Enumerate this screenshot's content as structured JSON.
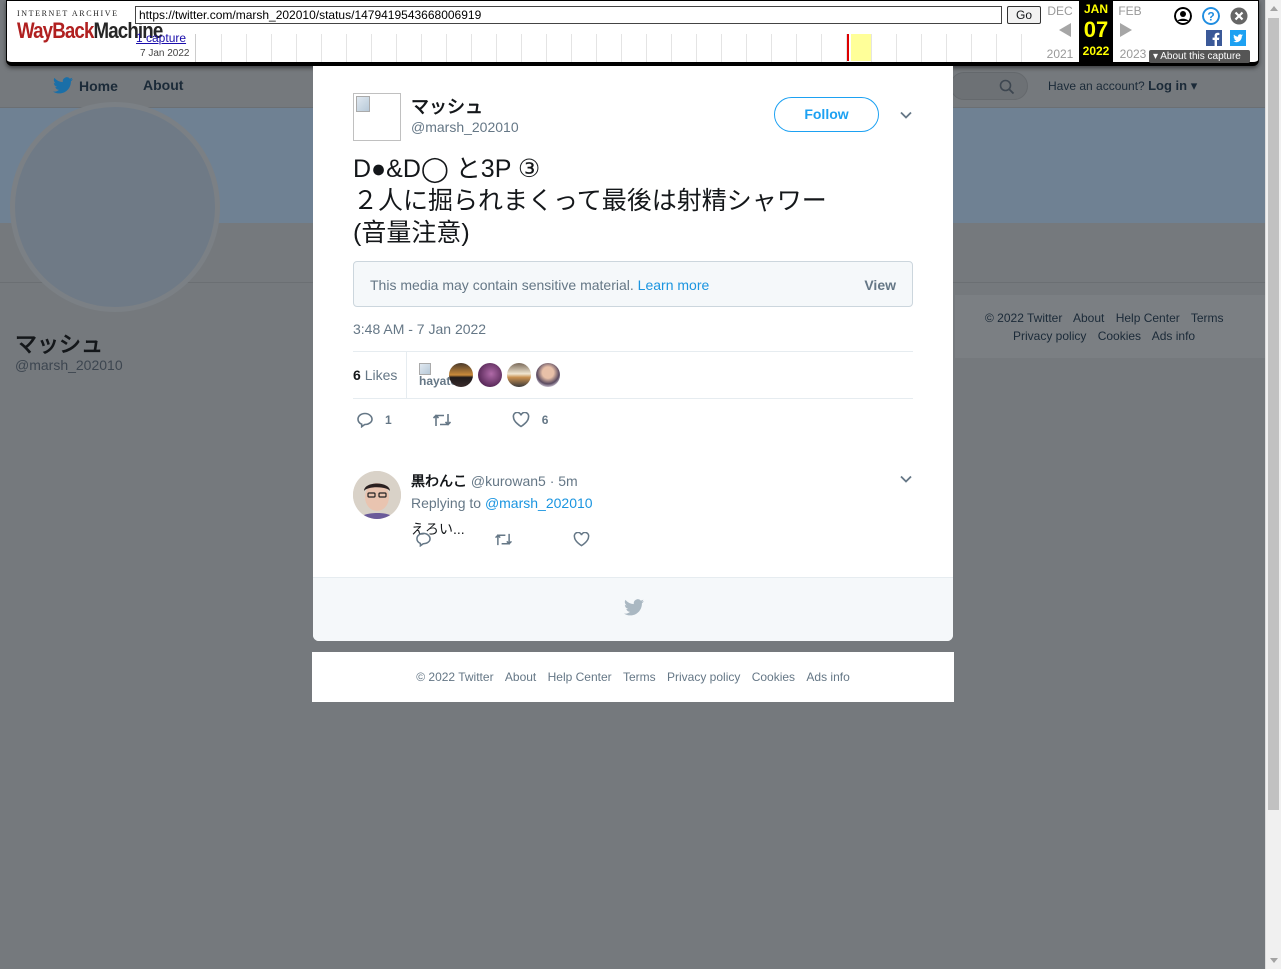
{
  "wayback": {
    "logo_top": "INTERNET ARCHIVE",
    "logo_main_a": "WayBack",
    "logo_main_b": "Machine",
    "url": "https://twitter.com/marsh_202010/status/1479419543668006919",
    "go_label": "Go",
    "captures_link": "1 capture",
    "capture_date": "7 Jan 2022",
    "prev_month": "DEC",
    "prev_year": "2021",
    "cur_month": "JAN",
    "cur_day": "07",
    "cur_year": "2022",
    "next_month": "FEB",
    "next_year": "2023",
    "about_capture": "About this capture"
  },
  "background": {
    "nav_home": "Home",
    "nav_about": "About",
    "account_prompt": "Have an account?",
    "login": "Log in",
    "profile_name": "マッシュ",
    "profile_handle": "@marsh_202010",
    "footer_links": [
      "© 2022 Twitter",
      "About",
      "Help Center",
      "Terms",
      "Privacy policy",
      "Cookies",
      "Ads info"
    ]
  },
  "tweet": {
    "name": "マッシュ",
    "handle": "@marsh_202010",
    "follow_label": "Follow",
    "text": "D●&D◯ と3P ③\n２人に掘られまくって最後は射精シャワー\n(音量注意)",
    "sensitive_msg": "This media may contain sensitive material.",
    "learn_more": "Learn more",
    "view_label": "View",
    "timestamp": "3:48 AM - 7 Jan 2022",
    "likes_count": "6",
    "likes_label": "Likes",
    "broken_liker_alt": "hayato",
    "reply_count": "1",
    "like_count": "6"
  },
  "reply": {
    "name": "黒わんこ",
    "handle": "@kurowan5",
    "time": "· 5m",
    "replying_to": "Replying to",
    "replying_handle": "@marsh_202010",
    "text": "えろい..."
  },
  "footer_links": [
    "© 2022 Twitter",
    "About",
    "Help Center",
    "Terms",
    "Privacy policy",
    "Cookies",
    "Ads info"
  ],
  "colors": {
    "accent": "#1da1f2",
    "link": "#1b95e0",
    "muted": "#657786",
    "wayback_highlight": "#ffff00"
  }
}
